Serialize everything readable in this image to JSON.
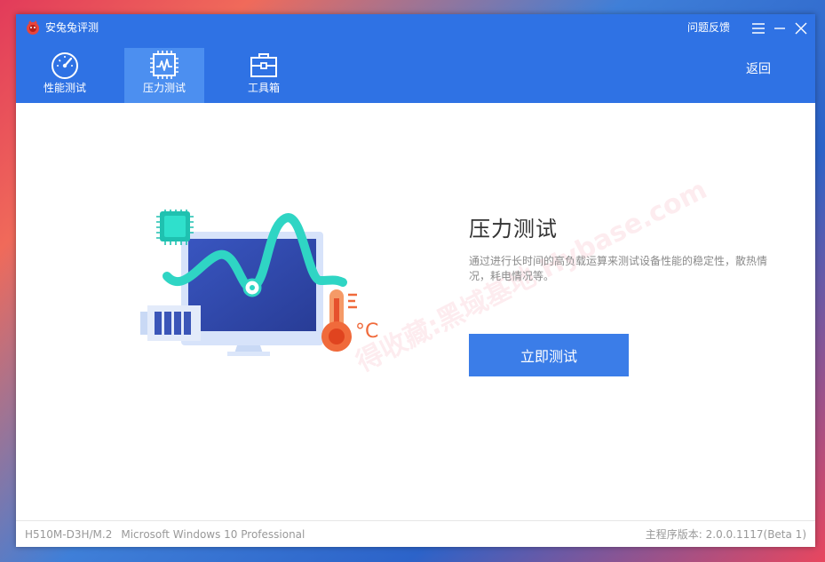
{
  "app": {
    "title": "安兔兔评测"
  },
  "titlebar": {
    "feedback_label": "问题反馈"
  },
  "nav": {
    "tabs": [
      {
        "label": "性能测试",
        "icon": "speedometer-icon",
        "active": false
      },
      {
        "label": "压力测试",
        "icon": "chip-pulse-icon",
        "active": true
      },
      {
        "label": "工具箱",
        "icon": "toolbox-icon",
        "active": false
      }
    ],
    "back_label": "返回"
  },
  "main": {
    "title": "压力测试",
    "description": "通过进行长时间的高负载运算来测试设备性能的稳定性，散热情况，耗电情况等。",
    "start_button_label": "立即测试",
    "celsius_label": "°C",
    "watermark_text": "得收藏:黑域基地 Hybase.com"
  },
  "status": {
    "board": "H510M-D3H/M.2",
    "os": "Microsoft Windows 10 Professional",
    "version": "主程序版本: 2.0.0.1117(Beta 1)"
  },
  "colors": {
    "header_blue": "#2f72e4",
    "active_tab": "#4c8ff0",
    "button_blue": "#3b7de8",
    "accent_teal": "#2fd5c4",
    "thermo_orange": "#f06a3b"
  }
}
